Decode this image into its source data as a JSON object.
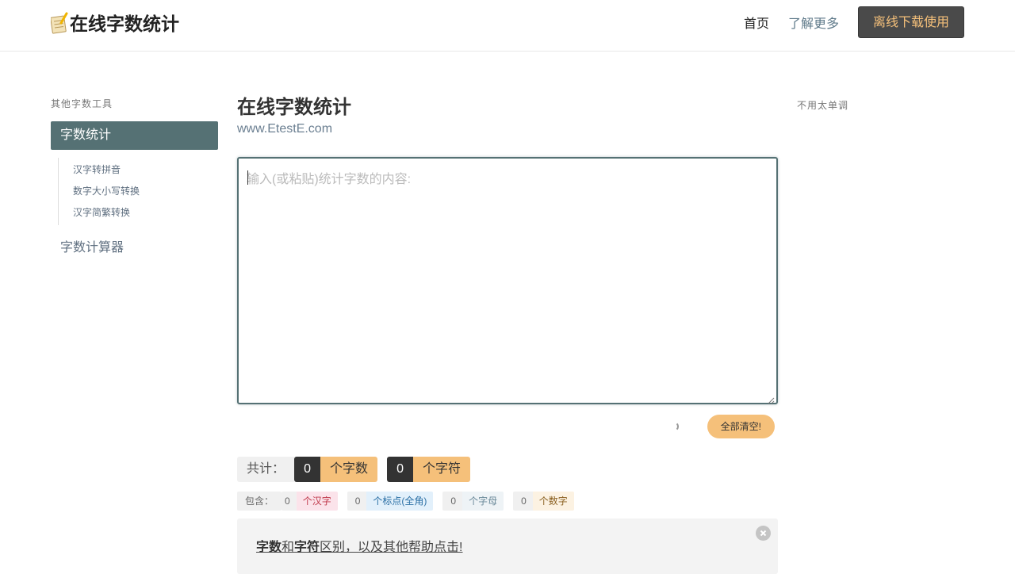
{
  "header": {
    "logo_text": "在线字数统计",
    "nav_home": "首页",
    "nav_more": "了解更多",
    "nav_download": "离线下载使用"
  },
  "sidebar": {
    "title": "其他字数工具",
    "active_item": "字数统计",
    "sub_items": [
      "汉字转拼音",
      "数字大小写转换",
      "汉字简繁转换"
    ],
    "calc_item": "字数计算器"
  },
  "main": {
    "title": "在线字数统计",
    "subtitle": "www.EtestE.com",
    "textarea_placeholder": "输入(或粘贴)统计字数的内容:",
    "clear_button": "全部清空!"
  },
  "totals": {
    "label": "共计：",
    "char_count": "0",
    "char_count_unit": "个字数",
    "symbol_count": "0",
    "symbol_count_unit": "个字符"
  },
  "includes": {
    "label": "包含：",
    "items": [
      {
        "value": "0",
        "unit": "个汉字",
        "bg": "#fbe3ea",
        "color": "#c0394b"
      },
      {
        "value": "0",
        "unit": "个标点(全角)",
        "bg": "#e2f0fb",
        "color": "#2a6fa5"
      },
      {
        "value": "0",
        "unit": "个字母",
        "bg": "#eef3f6",
        "color": "#6b8a9a"
      },
      {
        "value": "0",
        "unit": "个数字",
        "bg": "#fcf2e2",
        "color": "#8a6020"
      }
    ]
  },
  "help": {
    "bold1": "字数",
    "mid1": "和",
    "bold2": "字符",
    "rest": "区别，以及其他帮助点击!"
  },
  "right": {
    "text": "不用太单调"
  }
}
